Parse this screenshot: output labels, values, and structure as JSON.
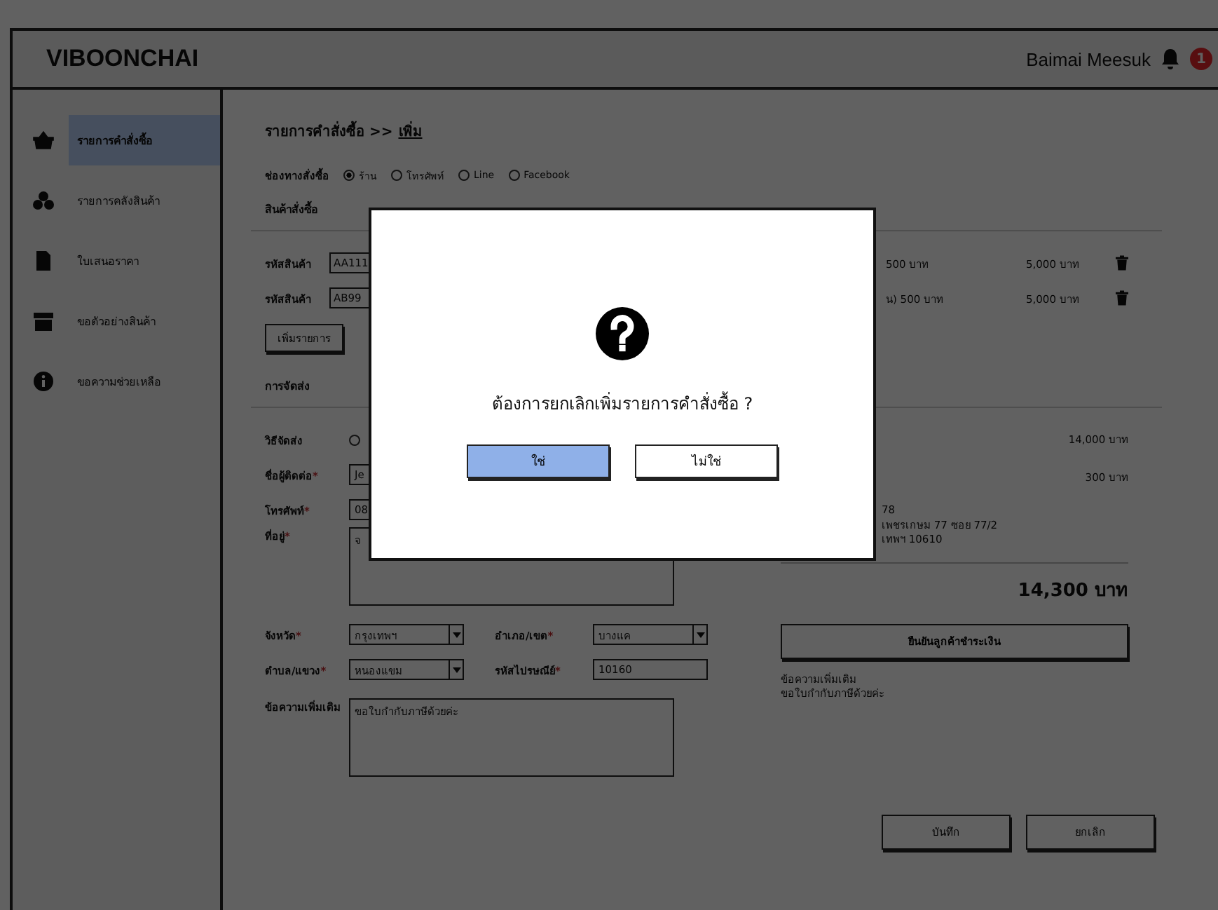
{
  "header": {
    "logo": "VIBOONCHAI",
    "user": "Baimai Meesuk",
    "notification_count": "1"
  },
  "sidebar": {
    "items": [
      {
        "label": "รายการคำสั่งซื้อ",
        "selected": true
      },
      {
        "label": "รายการคลังสินค้า",
        "selected": false
      },
      {
        "label": "ใบเสนอราคา",
        "selected": false
      },
      {
        "label": "ขอตัวอย่างสินค้า",
        "selected": false
      },
      {
        "label": "ขอความช่วยเหลือ",
        "selected": false
      }
    ]
  },
  "breadcrumb": {
    "parent": "รายการคำสั่งซื้อ >>",
    "current": "เพิ่ม"
  },
  "channel": {
    "label": "ช่องทางสั่งซื้อ",
    "options": [
      {
        "label": "ร้าน",
        "selected": true
      },
      {
        "label": "โทรศัพท์",
        "selected": false
      },
      {
        "label": "Line",
        "selected": false
      },
      {
        "label": "Facebook",
        "selected": false
      }
    ]
  },
  "products": {
    "title": "สินค้าสั่งซื้อ",
    "rows": [
      {
        "label": "รหัสสินค้า",
        "code": "AA111",
        "unit_price": "500 บาท",
        "total": "5,000 บาท"
      },
      {
        "label": "รหัสสินค้า",
        "code": "AB99",
        "unit_price": "น) 500 บาท",
        "total": "5,000 บาท"
      }
    ],
    "add_button": "เพิ่มรายการ"
  },
  "delivery": {
    "title": "การจัดส่ง",
    "method": {
      "label": "วิธีจัดส่ง",
      "options": [
        {
          "selected": false
        }
      ]
    },
    "contact": {
      "label": "ชื่อผู้ติดต่อ",
      "required_mark": "*",
      "value": "Je"
    },
    "phone": {
      "label": "โทรศัพท์",
      "required_mark": "*",
      "value": "08"
    },
    "address": {
      "label": "ที่อยู่",
      "required_mark": "*",
      "value": "จ"
    },
    "province": {
      "label": "จังหวัด",
      "required_mark": "*",
      "value": "กรุงเทพฯ"
    },
    "district": {
      "label": "อำเภอ/เขต",
      "required_mark": "*",
      "value": "บางแค"
    },
    "subdistrict": {
      "label": "ตำบล/แขวง",
      "required_mark": "*",
      "value": "หนองแขม"
    },
    "postcode": {
      "label": "รหัสไปรษณีย์",
      "required_mark": "*",
      "value": "10160"
    },
    "note": {
      "label": "ข้อความเพิ่มเติม",
      "value": "ขอใบกำกับภาษีด้วยค่ะ"
    }
  },
  "summary": {
    "subtotal": "14,000 บาท",
    "shipping": "300 บาท",
    "address_lines": [
      "78",
      "เพชรเกษม 77 ซอย 77/2",
      "เทพฯ 10610"
    ],
    "total": "14,300 บาท",
    "confirm_button": "ยืนยันลูกค้าชำระเงิน",
    "note_title": "ข้อความเพิ่มเติม",
    "note": "ขอใบกำกับภาษีด้วยค่ะ"
  },
  "actions": {
    "save": "บันทึก",
    "cancel": "ยกเลิก"
  },
  "dialog": {
    "message": "ต้องการยกเลิกเพิ่มรายการคำสั่งซื้อ ?",
    "buttons": [
      {
        "label": "ใช่",
        "primary": true
      },
      {
        "label": "ไม่ใช่",
        "primary": false
      }
    ]
  }
}
